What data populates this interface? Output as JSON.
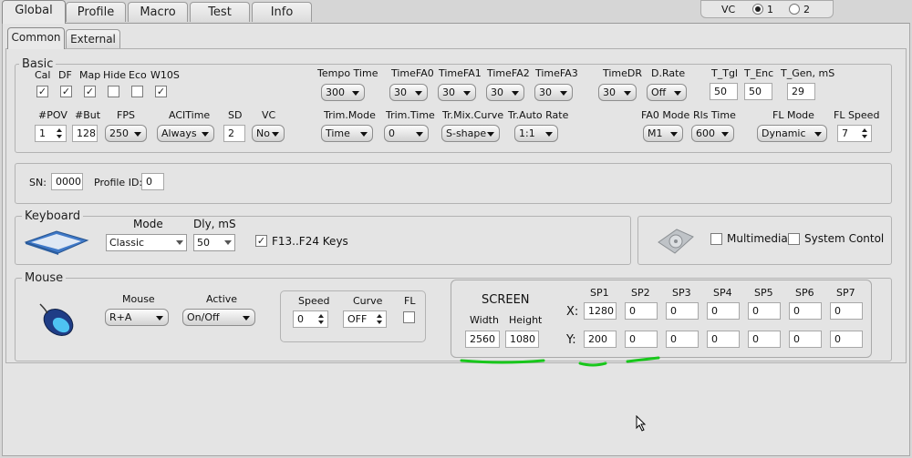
{
  "tabs": [
    "Global",
    "Profile",
    "Macro",
    "Test",
    "Info"
  ],
  "vc": {
    "label": "VC",
    "opt1": "1",
    "opt2": "2",
    "selected": "1"
  },
  "subtabs": [
    "Common",
    "External"
  ],
  "basic": {
    "title": "Basic",
    "cb": [
      {
        "label": "Cal",
        "checked": true
      },
      {
        "label": "DF",
        "checked": true
      },
      {
        "label": "Map",
        "checked": true
      },
      {
        "label": "Hide",
        "checked": false
      },
      {
        "label": "Eco",
        "checked": false
      },
      {
        "label": "W10S",
        "checked": true
      }
    ],
    "tempo_time": {
      "label": "Tempo Time",
      "value": "300"
    },
    "timefa0": {
      "label": "TimeFA0",
      "value": "30"
    },
    "timefa1": {
      "label": "TimeFA1",
      "value": "30"
    },
    "timefa2": {
      "label": "TimeFA2",
      "value": "30"
    },
    "timefa3": {
      "label": "TimeFA3",
      "value": "30"
    },
    "timedr": {
      "label": "TimeDR",
      "value": "30"
    },
    "drate": {
      "label": "D.Rate",
      "value": "Off"
    },
    "t_tgl": {
      "label": "T_Tgl",
      "value": "50"
    },
    "t_enc": {
      "label": "T_Enc",
      "value": "50"
    },
    "t_gen": {
      "label": "T_Gen, mS",
      "value": "29"
    },
    "pov": {
      "label": "#POV",
      "value": "1"
    },
    "but": {
      "label": "#But",
      "value": "128"
    },
    "fps": {
      "label": "FPS",
      "value": "250"
    },
    "acitime": {
      "label": "ACITime",
      "value": "Always"
    },
    "sd": {
      "label": "SD",
      "value": "2"
    },
    "vc": {
      "label": "VC",
      "value": "No"
    },
    "trim_mode": {
      "label": "Trim.Mode",
      "value": "Time"
    },
    "trim_time": {
      "label": "Trim.Time",
      "value": "0"
    },
    "tr_mix": {
      "label": "Tr.Mix.Curve",
      "value": "S-shape"
    },
    "tr_auto": {
      "label": "Tr.Auto Rate",
      "value": "1:1"
    },
    "fa0_mode": {
      "label": "FA0 Mode",
      "value": "M1"
    },
    "rls_time": {
      "label": "Rls Time",
      "value": "600"
    },
    "fl_mode": {
      "label": "FL Mode",
      "value": "Dynamic"
    },
    "fl_speed": {
      "label": "FL Speed",
      "value": "7"
    }
  },
  "ids": {
    "sn_label": "SN:",
    "sn_value": "0000",
    "profile_label": "Profile ID:",
    "profile_value": "0"
  },
  "keyboard": {
    "title": "Keyboard",
    "mode_label": "Mode",
    "mode_value": "Classic",
    "dly_label": "Dly, mS",
    "dly_value": "50",
    "f_keys_label": "F13..F24 Keys",
    "f_keys_checked": true
  },
  "media": {
    "multimedia_label": "Multimedia",
    "system_label": "System Contol"
  },
  "mouse": {
    "title": "Mouse",
    "mouse_label": "Mouse",
    "mouse_value": "R+A",
    "active_label": "Active",
    "active_value": "On/Off",
    "speed_label": "Speed",
    "speed_value": "0",
    "curve_label": "Curve",
    "curve_value": "OFF",
    "fl_label": "FL"
  },
  "screen": {
    "title": "SCREEN",
    "width_label": "Width",
    "height_label": "Height",
    "width": "2560",
    "height": "1080",
    "x_label": "X:",
    "y_label": "Y:",
    "sp": [
      {
        "label": "SP1",
        "x": "1280",
        "y": "200"
      },
      {
        "label": "SP2",
        "x": "0",
        "y": "0"
      },
      {
        "label": "SP3",
        "x": "0",
        "y": "0"
      },
      {
        "label": "SP4",
        "x": "0",
        "y": "0"
      },
      {
        "label": "SP5",
        "x": "0",
        "y": "0"
      },
      {
        "label": "SP6",
        "x": "0",
        "y": "0"
      },
      {
        "label": "SP7",
        "x": "0",
        "y": "0"
      }
    ]
  },
  "colors": {
    "annotation": "#18c71b",
    "background": "#d6d6d6",
    "panel": "#e4e4e4"
  }
}
